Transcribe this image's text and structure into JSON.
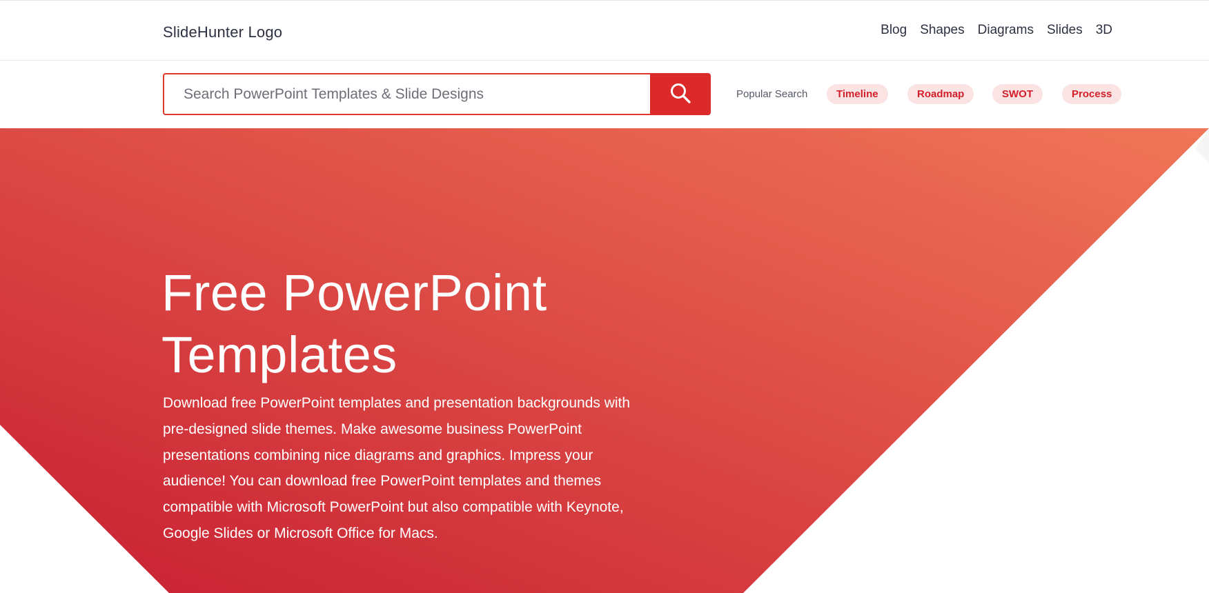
{
  "header": {
    "logo_text": "SlideHunter Logo",
    "nav": [
      "Blog",
      "Shapes",
      "Diagrams",
      "Slides",
      "3D"
    ]
  },
  "search": {
    "placeholder": "Search PowerPoint Templates & Slide Designs",
    "value": "",
    "button_icon": "search-icon"
  },
  "popular": {
    "label": "Popular Search",
    "tags": [
      "Timeline",
      "Roadmap",
      "SWOT",
      "Process"
    ]
  },
  "hero": {
    "title_line1": "Free PowerPoint",
    "title_line2": "Templates",
    "description": "Download free PowerPoint templates and presentation backgrounds with pre-designed slide themes. Make awesome business PowerPoint presentations combining nice diagrams and graphics. Impress your audience! You can download free PowerPoint templates and themes compatible with Microsoft PowerPoint but also compatible with Keynote, Google Slides or Microsoft Office for Macs."
  },
  "colors": {
    "accent": "#dc2a2a",
    "gradient_start": "#c81f32",
    "gradient_end": "#f07658",
    "chip_bg": "#fbe3e3",
    "chip_text": "#d21f2a"
  }
}
